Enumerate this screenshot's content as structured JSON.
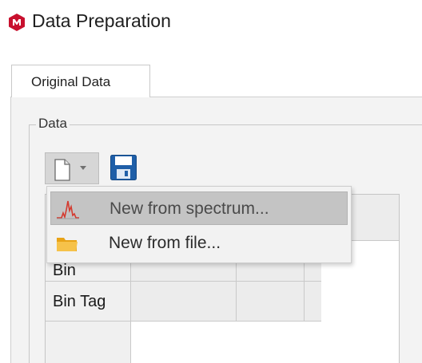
{
  "window": {
    "title": "Data Preparation",
    "logo_icon": "app-logo-icon",
    "logo_color": "#c8102e"
  },
  "tabs": [
    {
      "label": "Original Data",
      "active": true
    }
  ],
  "group": {
    "legend": "Data"
  },
  "toolbar": {
    "new_icon": "new-document-icon",
    "save_icon": "save-icon"
  },
  "menu": {
    "items": [
      {
        "label": "New from spectrum...",
        "icon": "spectrum-icon",
        "highlighted": true
      },
      {
        "label": "New from file...",
        "icon": "folder-icon",
        "highlighted": false
      }
    ]
  },
  "grid": {
    "row_labels": [
      "Bin",
      "Bin Tag"
    ]
  }
}
